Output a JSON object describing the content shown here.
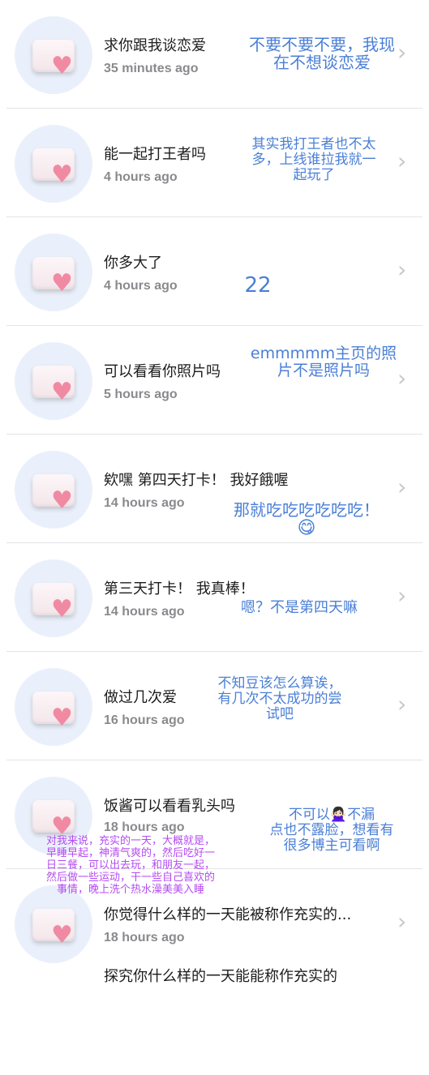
{
  "questions": [
    {
      "text": "求你跟我谈恋爱",
      "time": "35 minutes ago"
    },
    {
      "text": "能一起打王者吗",
      "time": "4 hours ago"
    },
    {
      "text": "你多大了",
      "time": "4 hours ago"
    },
    {
      "text": "可以看看你照片吗",
      "time": "5 hours ago"
    },
    {
      "text": "欸嘿 第四天打卡！ 我好餓喔",
      "time": "14 hours ago"
    },
    {
      "text": "第三天打卡！ 我真棒！",
      "time": "14 hours ago"
    },
    {
      "text": "做过几次爱",
      "time": "16 hours ago"
    },
    {
      "text": "饭酱可以看看乳头吗",
      "time": "18 hours ago"
    },
    {
      "text": "你觉得什么样的一天能被称作充实的...",
      "time": "18 hours ago"
    },
    {
      "text": "探究你什么样的一天能能称作充实的",
      "time": ""
    }
  ],
  "answers": [
    {
      "line1": "不要不要不要，我现",
      "line2": "在不想谈恋爱"
    },
    {
      "line1": "其实我打王者也不太",
      "line2": "多，上线谁拉我就一",
      "line3": "起玩了"
    },
    {
      "line1": "22"
    },
    {
      "line1": "emmmmm主页的照",
      "line2": "片不是照片吗"
    },
    {
      "line1": "那就吃吃吃吃吃吃！",
      "emoji": "😋"
    },
    {
      "line1": "嗯？不是第四天嘛"
    },
    {
      "line1": "不知豆该怎么算诶，",
      "line2": "有几次不太成功的尝",
      "line3": "试吧"
    },
    {
      "line1": "不可以🙅🏻‍♀️不漏",
      "line2": "点也不露脸，想看有",
      "line3": "很多博主可看啊"
    }
  ],
  "answer_extra": {
    "line1": "对我来说，充实的一天，大概就是，",
    "line2": "早睡早起，神清气爽的，然后吃好一",
    "line3": "日三餐，可以出去玩，和朋友一起，",
    "line4": "然后做一些运动，干一些自己喜欢的",
    "line5": "事情，晚上洗个热水澡美美入睡"
  },
  "icons": {
    "avatar": "envelope-heart-icon",
    "chevron": "chevron-right-icon"
  },
  "colors": {
    "answer_blue": "#4a7fd6",
    "answer_purple": "#b44cf0",
    "avatar_bg": "#eaf0fb",
    "heart": "#f08aa3"
  }
}
